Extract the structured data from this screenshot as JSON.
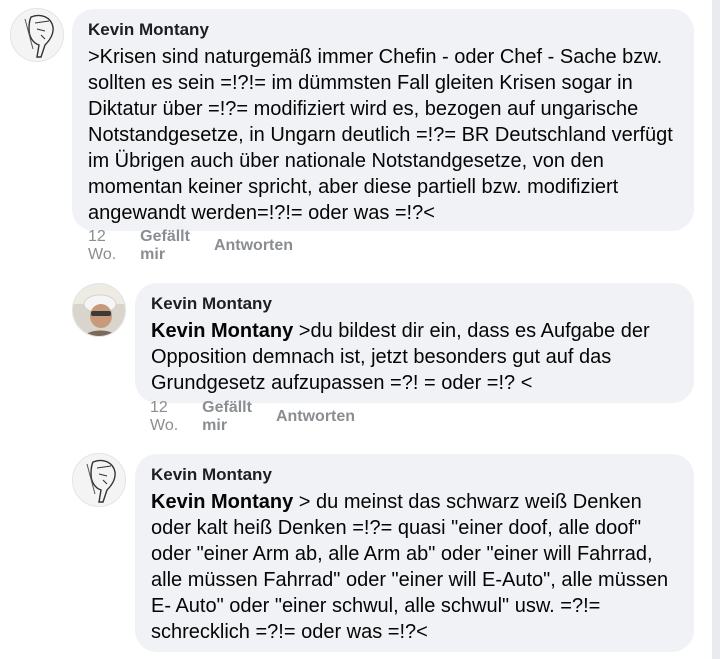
{
  "comments": [
    {
      "author": "Kevin Montany",
      "text": ">Krisen sind  naturgemäß immer Chefin - oder Chef - Sache bzw. sollten es sein =!?!= im dümmsten Fall gleiten Krisen sogar in Diktatur über =!?= modifiziert wird es, bezogen auf ungarische Notstandgesetze, in Ungarn deutlich =!?= BR Deutschland verfügt im Übrigen auch über nationale Notstandgesetze, von den momentan keiner spricht, aber diese partiell bzw. modifiziert angewandt werden=!?!= oder was =!?<",
      "time": "12 Wo.",
      "like": "Gefällt mir",
      "reply": "Antworten",
      "avatar_icon": "sketch-face-icon"
    },
    {
      "author": "Kevin Montany",
      "mention": "Kevin Montany",
      "text": " >du bildest dir ein, dass es  Aufgabe der Opposition  demnach ist, jetzt besonders gut auf das Grundgesetz aufzupassen =?! = oder =!? <",
      "time": "12 Wo.",
      "like": "Gefällt mir",
      "reply": "Antworten",
      "avatar_icon": "photo-avatar-icon"
    },
    {
      "author": "Kevin Montany",
      "mention": "Kevin Montany",
      "text": " > du meinst das schwarz weiß Denken oder kalt heiß Denken =!?= quasi \"einer doof, alle doof\" oder \"einer Arm ab, alle Arm ab\" oder \"einer will Fahrrad, alle müssen Fahrrad\" oder \"einer will E-Auto\", alle müssen E- Auto\" oder \"einer schwul, alle schwul\" usw. =?!= schrecklich =?!= oder was =!?<",
      "avatar_icon": "sketch-face-icon"
    }
  ],
  "colors": {
    "bubble": "#f0f2f5",
    "meta": "#8a8d91",
    "text": "#050505"
  }
}
